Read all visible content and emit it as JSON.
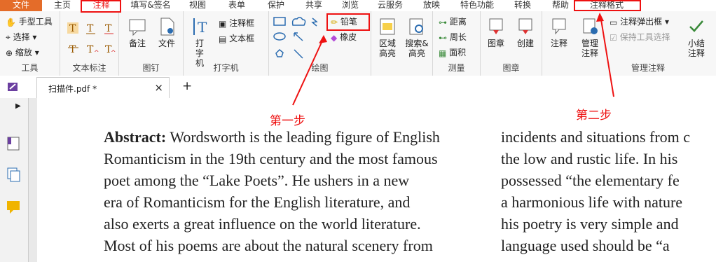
{
  "tabs": [
    "文件",
    "主页",
    "注释",
    "填写&签名",
    "视图",
    "表单",
    "保护",
    "共享",
    "浏览",
    "云服务",
    "放映",
    "特色功能",
    "转换",
    "帮助",
    "注释格式"
  ],
  "groups": {
    "tools": {
      "label": "工具",
      "items": [
        "手型工具",
        "选择",
        "缩放"
      ]
    },
    "text_markup": {
      "label": "文本标注"
    },
    "pin": {
      "label": "图钉",
      "items": [
        "备注",
        "文件"
      ]
    },
    "typewriter": {
      "label": "打字机",
      "items": [
        "打字机",
        "注释框",
        "文本框"
      ]
    },
    "drawing": {
      "label": "绘图",
      "pencil": "铅笔",
      "eraser": "橡皮"
    },
    "area": {
      "items": [
        "区域高亮",
        "搜索&高亮"
      ]
    },
    "measure": {
      "label": "测量",
      "items": [
        "距离",
        "周长",
        "面积"
      ]
    },
    "stamp": {
      "label": "图章",
      "items": [
        "图章",
        "创建"
      ]
    },
    "manage": {
      "label": "管理注释",
      "items": [
        "注释",
        "管理注释",
        "注释弹出框",
        "保持工具选择",
        "小结注释"
      ]
    }
  },
  "doc_tab": {
    "name": "扫描件.pdf *",
    "close": "×",
    "add": "+"
  },
  "annotations": {
    "step1": "第一步",
    "step2": "第二步"
  },
  "doc_left": [
    "Abstract: Wordsworth is the leading figure of English",
    "Romanticism in the 19th century and the most famous",
    "poet among the “Lake Poets”. He ushers in a new",
    "era of Romanticism for the English literature, and",
    "also exerts a great influence on the world literature.",
    "Most of his poems are about the natural scenery from"
  ],
  "doc_right": [
    "incidents and situations from c",
    "the low and rustic life. In his",
    "possessed “the elementary fe",
    "a harmonious life with nature",
    "his poetry is very simple and",
    "language used should be “a"
  ],
  "colors": {
    "file_tab": "#e46c29",
    "highlight": "#e11111",
    "accent": "#2b6cb0"
  }
}
